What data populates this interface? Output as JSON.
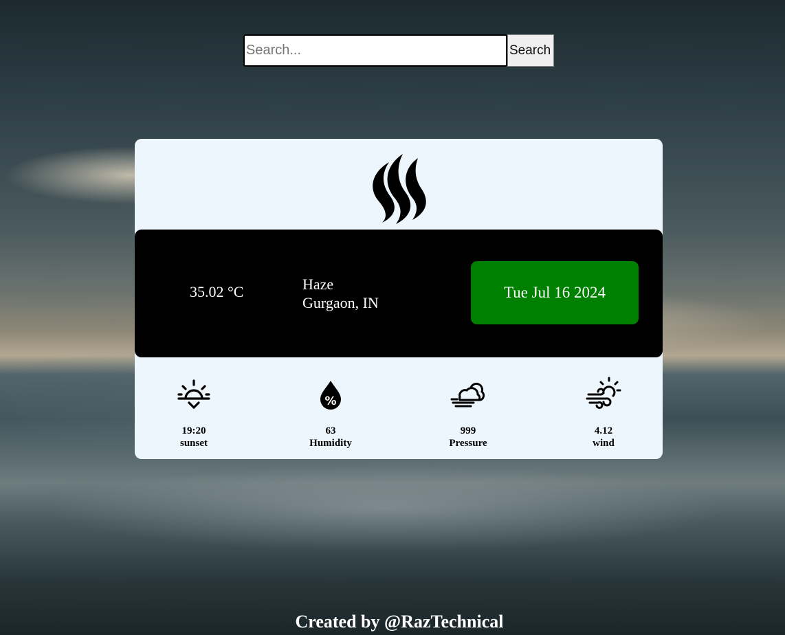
{
  "search": {
    "placeholder": "Search...",
    "button_label": "Search"
  },
  "weather": {
    "logo_icon": "smoke-haze-icon",
    "temperature": "35.02 °C",
    "condition": "Haze",
    "location": "Gurgaon, IN",
    "date": "Tue Jul 16 2024",
    "date_color": "#008000"
  },
  "stats": [
    {
      "icon": "sunset-icon",
      "value": "19:20",
      "label": "sunset"
    },
    {
      "icon": "humidity-drop-icon",
      "value": "63",
      "label": "Humidity"
    },
    {
      "icon": "cloud-wind-icon",
      "value": "999",
      "label": "Pressure"
    },
    {
      "icon": "wind-sun-icon",
      "value": "4.12",
      "label": "wind"
    }
  ],
  "footer": {
    "credit": "Created by @RazTechnical"
  }
}
